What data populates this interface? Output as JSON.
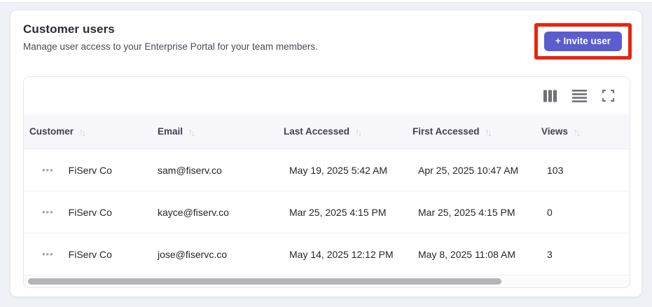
{
  "page": {
    "title": "Customer users",
    "subtitle": "Manage user access to your Enterprise Portal for your team members."
  },
  "invite": {
    "label": "+ Invite user",
    "button_color": "#5a5cd0",
    "annotation_highlight_color": "#e8250e"
  },
  "toolbar": {
    "icons": [
      "columns-icon",
      "row-density-icon",
      "fullscreen-icon"
    ],
    "icon_color": "#6f6f78"
  },
  "table": {
    "columns": [
      {
        "label": "Customer",
        "sortable": true
      },
      {
        "label": "Email",
        "sortable": true
      },
      {
        "label": "Last Accessed",
        "sortable": true
      },
      {
        "label": "First Accessed",
        "sortable": true
      },
      {
        "label": "Views",
        "sortable": true
      }
    ],
    "row_actions_icon": "ellipsis-icon",
    "rows": [
      {
        "customer": "FiServ Co",
        "email": "sam@fiserv.co",
        "last_accessed": "May 19, 2025 5:42 AM",
        "first_accessed": "Apr 25, 2025 10:47 AM",
        "views": "103"
      },
      {
        "customer": "FiServ Co",
        "email": "kayce@fiserv.co",
        "last_accessed": "Mar 25, 2025 4:15 PM",
        "first_accessed": "Mar 25, 2025 4:15 PM",
        "views": "0"
      },
      {
        "customer": "FiServ Co",
        "email": "jose@fiservc.co",
        "last_accessed": "May 14, 2025 12:12 PM",
        "first_accessed": "May 8, 2025 11:08 AM",
        "views": "3"
      }
    ]
  },
  "glyphs": {
    "dots": "•••",
    "sort_up": "↑",
    "sort_down": "↓"
  }
}
